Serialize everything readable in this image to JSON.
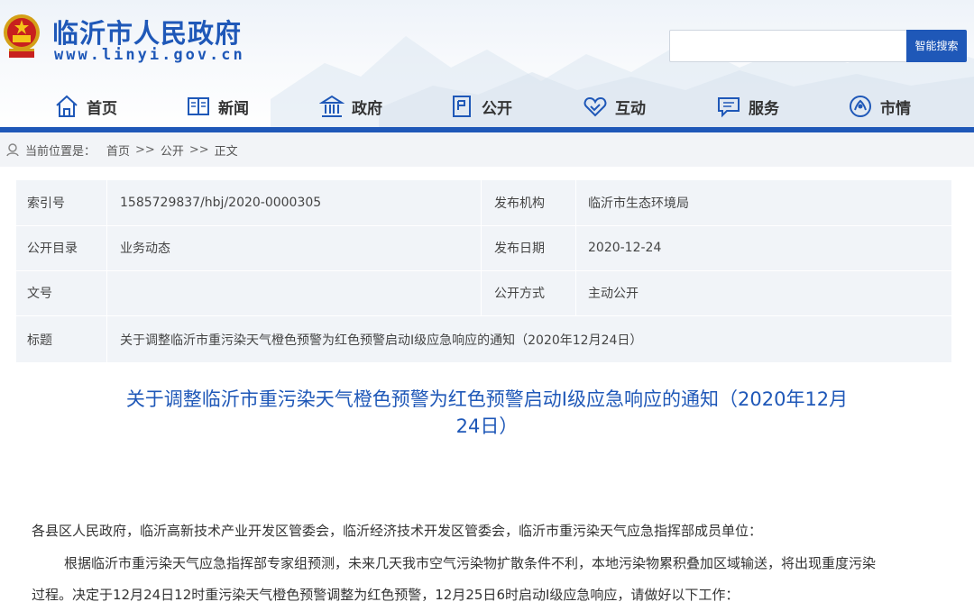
{
  "header": {
    "site_title": "临沂市人民政府",
    "site_url": "www.linyi.gov.cn",
    "search_button": "智能搜索",
    "search_value": "",
    "brand_color": "#1f58b8"
  },
  "nav": {
    "items": [
      {
        "label": "首页",
        "icon": "home-icon"
      },
      {
        "label": "新闻",
        "icon": "newspaper-icon"
      },
      {
        "label": "政府",
        "icon": "government-building-icon"
      },
      {
        "label": "公开",
        "icon": "document-icon"
      },
      {
        "label": "互动",
        "icon": "handshake-icon"
      },
      {
        "label": "服务",
        "icon": "chat-service-icon"
      },
      {
        "label": "市情",
        "icon": "city-info-icon"
      }
    ]
  },
  "breadcrumb": {
    "prefix": "当前位置是：",
    "items": [
      "首页",
      "公开",
      "正文"
    ],
    "separator": ">>"
  },
  "info": {
    "rows": [
      {
        "label1": "索引号",
        "value1": "1585729837/hbj/2020-0000305",
        "label2": "发布机构",
        "value2": "临沂市生态环境局"
      },
      {
        "label1": "公开目录",
        "value1": "业务动态",
        "label2": "发布日期",
        "value2": "2020-12-24"
      },
      {
        "label1": "文号",
        "value1": "",
        "label2": "公开方式",
        "value2": "主动公开"
      }
    ],
    "title_label": "标题",
    "title_value": "关于调整临沂市重污染天气橙色预警为红色预警启动Ⅰ级应急响应的通知（2020年12月24日）"
  },
  "article": {
    "title_line1": "关于调整临沂市重污染天气橙色预警为红色预警启动Ⅰ级应急响应的通知（2020年12月",
    "title_line2": "24日）",
    "salutation": "各县区人民政府，临沂高新技术产业开发区管委会，临沂经济技术开发区管委会，临沂市重污染天气应急指挥部成员单位：",
    "para1_line1": "根据临沂市重污染天气应急指挥部专家组预测，未来几天我市空气污染物扩散条件不利，本地污染物累积叠加区域输送，将出现重度污染",
    "para1_line2": "过程。决定于12月24日12时重污染天气橙色预警调整为红色预警，12月25日6时启动Ⅰ级应急响应，请做好以下工作："
  }
}
